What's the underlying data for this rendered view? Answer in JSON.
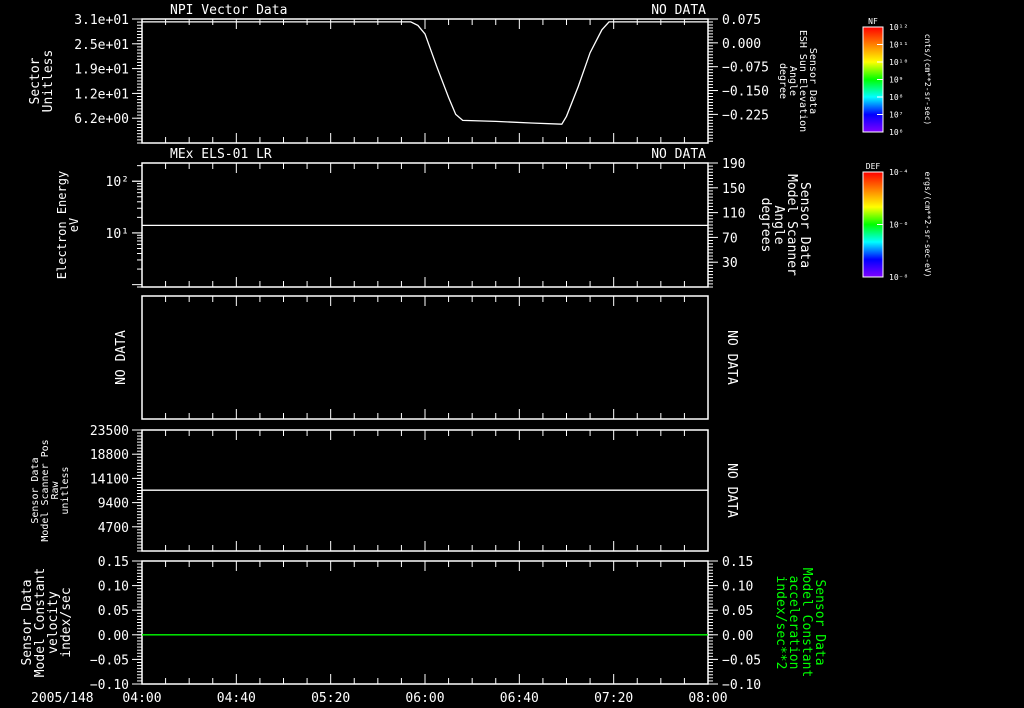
{
  "time_axis": {
    "date_label": "2005/148",
    "range": [
      "04:00",
      "08:00"
    ],
    "tick_labels": [
      "04:00",
      "04:40",
      "05:20",
      "06:00",
      "06:40",
      "07:20",
      "08:00"
    ],
    "minor_step_minutes": 10
  },
  "colorbars": [
    {
      "label": "NF",
      "units": "cnts/(cm**2-sr-sec)",
      "tick_labels": [
        "10¹²",
        "10¹¹",
        "10¹⁰",
        "10⁹",
        "10⁸",
        "10⁷",
        "10⁶"
      ],
      "colors": [
        "#ff0000",
        "#ff8000",
        "#ffff00",
        "#00ff00",
        "#00ffff",
        "#0000ff",
        "#8000ff"
      ]
    },
    {
      "label": "DEF",
      "units": "ergs/(cm**2-sr-sec-eV)",
      "tick_labels": [
        "10⁻⁴",
        "10⁻⁶",
        "10⁻⁸"
      ],
      "colors": [
        "#ff0000",
        "#ff8000",
        "#ffff00",
        "#00ff00",
        "#00ffff",
        "#0000ff",
        "#8000ff"
      ]
    }
  ],
  "chart_data": [
    {
      "type": "line",
      "title": "NPI Vector Data",
      "status": "NO DATA",
      "ylabel": [
        "Sector",
        "Unitless"
      ],
      "ylim": [
        0,
        31
      ],
      "yscale": "linear",
      "yticks": [
        {
          "v": 31,
          "label": "3.1e+01"
        },
        {
          "v": 24.8,
          "label": "2.5e+01"
        },
        {
          "v": 18.6,
          "label": "1.9e+01"
        },
        {
          "v": 12.4,
          "label": "1.2e+01"
        },
        {
          "v": 6.2,
          "label": "6.2e+00"
        }
      ],
      "y2label": [
        "Sensor Data",
        "ESH Sun Elevation",
        "Angle",
        "degree"
      ],
      "y2lim": [
        -0.315,
        0.075
      ],
      "y2ticks": [
        {
          "v": 0.075,
          "label": "0.075"
        },
        {
          "v": 0.0,
          "label": "0.000"
        },
        {
          "v": -0.075,
          "label": "−0.075"
        },
        {
          "v": -0.15,
          "label": "−0.150"
        },
        {
          "v": -0.225,
          "label": "−0.225"
        }
      ],
      "series": [
        {
          "axis": "right",
          "color": "#ffffff",
          "points": [
            [
              "04:00",
              0.066
            ],
            [
              "05:54",
              0.066
            ],
            [
              "05:57",
              0.055
            ],
            [
              "06:00",
              0.028
            ],
            [
              "06:05",
              -0.075
            ],
            [
              "06:10",
              -0.172
            ],
            [
              "06:13",
              -0.225
            ],
            [
              "06:16",
              -0.244
            ],
            [
              "06:30",
              -0.247
            ],
            [
              "06:45",
              -0.252
            ],
            [
              "06:58",
              -0.256
            ],
            [
              "07:00",
              -0.231
            ],
            [
              "07:05",
              -0.137
            ],
            [
              "07:10",
              -0.031
            ],
            [
              "07:15",
              0.041
            ],
            [
              "07:18",
              0.066
            ],
            [
              "08:00",
              0.066
            ]
          ]
        }
      ]
    },
    {
      "type": "line",
      "title": "MEx ELS-01 LR",
      "status": "NO DATA",
      "ylabel": [
        "Electron Energy",
        "eV"
      ],
      "ylim": [
        0.9,
        225
      ],
      "yscale": "log",
      "yticks": [
        {
          "v": 100,
          "label": "10²"
        },
        {
          "v": 10,
          "label": "10¹"
        }
      ],
      "y2label": [
        "Sensor Data",
        "Model Scanner",
        "Angle",
        "degrees"
      ],
      "y2lim": [
        -10,
        190
      ],
      "y2ticks": [
        {
          "v": 190,
          "label": "190"
        },
        {
          "v": 150,
          "label": "150"
        },
        {
          "v": 110,
          "label": "110"
        },
        {
          "v": 70,
          "label": "70"
        },
        {
          "v": 30,
          "label": "30"
        }
      ],
      "series": [
        {
          "axis": "left",
          "color": "#ffffff",
          "points": [
            [
              "04:00",
              14
            ],
            [
              "08:00",
              14
            ]
          ]
        }
      ]
    },
    {
      "type": "line",
      "title": "",
      "status": "",
      "ylabel": [
        "NO DATA"
      ],
      "y2label": [
        "NO DATA"
      ],
      "yticks": [],
      "y2ticks": [],
      "series": []
    },
    {
      "type": "line",
      "title": "",
      "status": "",
      "ylabel": [
        "Sensor Data",
        "Model Scanner Pos",
        "Raw",
        "unitless"
      ],
      "ylim": [
        0,
        23500
      ],
      "yscale": "linear",
      "yticks": [
        {
          "v": 23500,
          "label": "23500"
        },
        {
          "v": 18800,
          "label": "18800"
        },
        {
          "v": 14100,
          "label": "14100"
        },
        {
          "v": 9400,
          "label": "9400"
        },
        {
          "v": 4700,
          "label": "4700"
        }
      ],
      "y2label": [
        "NO DATA"
      ],
      "y2ticks": [],
      "series": [
        {
          "axis": "left",
          "color": "#ffffff",
          "points": [
            [
              "04:00",
              11800
            ],
            [
              "08:00",
              11800
            ]
          ]
        }
      ]
    },
    {
      "type": "line",
      "title": "",
      "status": "",
      "ylabel": [
        "Sensor Data",
        "Model Constant",
        "velocity",
        "index/sec"
      ],
      "ylim": [
        -0.1,
        0.15
      ],
      "yscale": "linear",
      "yticks": [
        {
          "v": 0.15,
          "label": "0.15"
        },
        {
          "v": 0.1,
          "label": "0.10"
        },
        {
          "v": 0.05,
          "label": "0.05"
        },
        {
          "v": 0.0,
          "label": "0.00"
        },
        {
          "v": -0.05,
          "label": "−0.05"
        },
        {
          "v": -0.1,
          "label": "−0.10"
        }
      ],
      "y2label": [
        "Sensor Data",
        "Model Constant",
        "acceleration",
        "index/sec**2"
      ],
      "y2label_color": "#00ff00",
      "y2lim": [
        -0.1,
        0.15
      ],
      "y2ticks": [
        {
          "v": 0.15,
          "label": "0.15"
        },
        {
          "v": 0.1,
          "label": "0.10"
        },
        {
          "v": 0.05,
          "label": "0.05"
        },
        {
          "v": 0.0,
          "label": "0.00"
        },
        {
          "v": -0.05,
          "label": "−0.05"
        },
        {
          "v": -0.1,
          "label": "−0.10"
        }
      ],
      "series": [
        {
          "axis": "left",
          "color": "#00ff00",
          "points": [
            [
              "04:00",
              0
            ],
            [
              "08:00",
              0
            ]
          ]
        }
      ]
    }
  ]
}
